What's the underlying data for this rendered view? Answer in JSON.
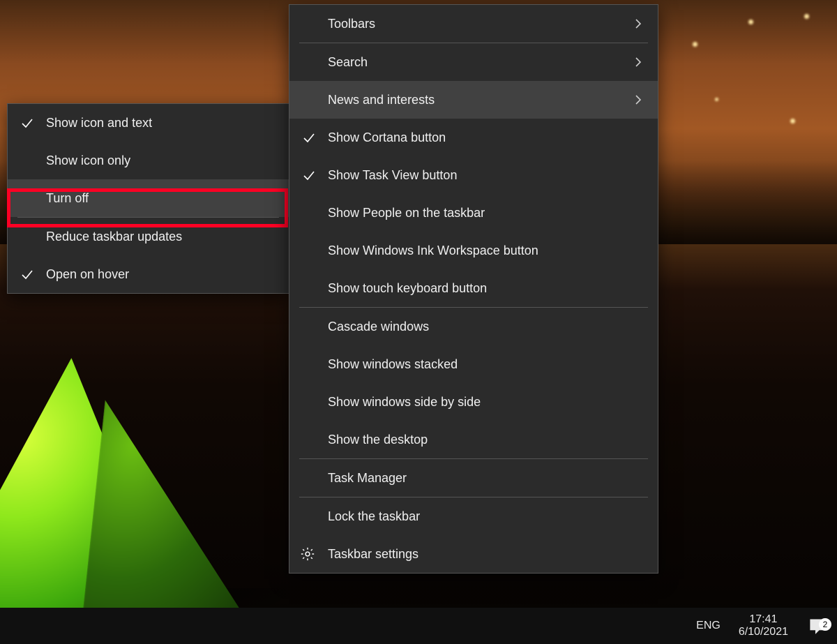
{
  "submenu": {
    "items": [
      {
        "label": "Show icon and text",
        "checked": true
      },
      {
        "label": "Show icon only",
        "checked": false
      },
      {
        "label": "Turn off",
        "checked": false,
        "highlighted_red": true,
        "selected": true
      }
    ],
    "items2": [
      {
        "label": "Reduce taskbar updates",
        "checked": false
      },
      {
        "label": "Open on hover",
        "checked": true
      }
    ]
  },
  "main_menu": {
    "group1": [
      {
        "label": "Toolbars",
        "has_submenu": true
      },
      {
        "label": "Search",
        "has_submenu": true
      },
      {
        "label": "News and interests",
        "has_submenu": true,
        "selected": true
      }
    ],
    "group2": [
      {
        "label": "Show Cortana button",
        "checked": true
      },
      {
        "label": "Show Task View button",
        "checked": true
      },
      {
        "label": "Show People on the taskbar",
        "checked": false
      },
      {
        "label": "Show Windows Ink Workspace button",
        "checked": false
      },
      {
        "label": "Show touch keyboard button",
        "checked": false
      }
    ],
    "group3": [
      {
        "label": "Cascade windows"
      },
      {
        "label": "Show windows stacked"
      },
      {
        "label": "Show windows side by side"
      },
      {
        "label": "Show the desktop"
      }
    ],
    "group4": [
      {
        "label": "Task Manager"
      }
    ],
    "group5": [
      {
        "label": "Lock the taskbar"
      },
      {
        "label": "Taskbar settings",
        "icon": "gear"
      }
    ]
  },
  "taskbar": {
    "language": "ENG",
    "time": "17:41",
    "date": "6/10/2021",
    "notification_count": "2"
  },
  "colors": {
    "menu_bg": "#2b2b2b",
    "menu_hover": "#414141",
    "highlight": "#ff0024"
  }
}
